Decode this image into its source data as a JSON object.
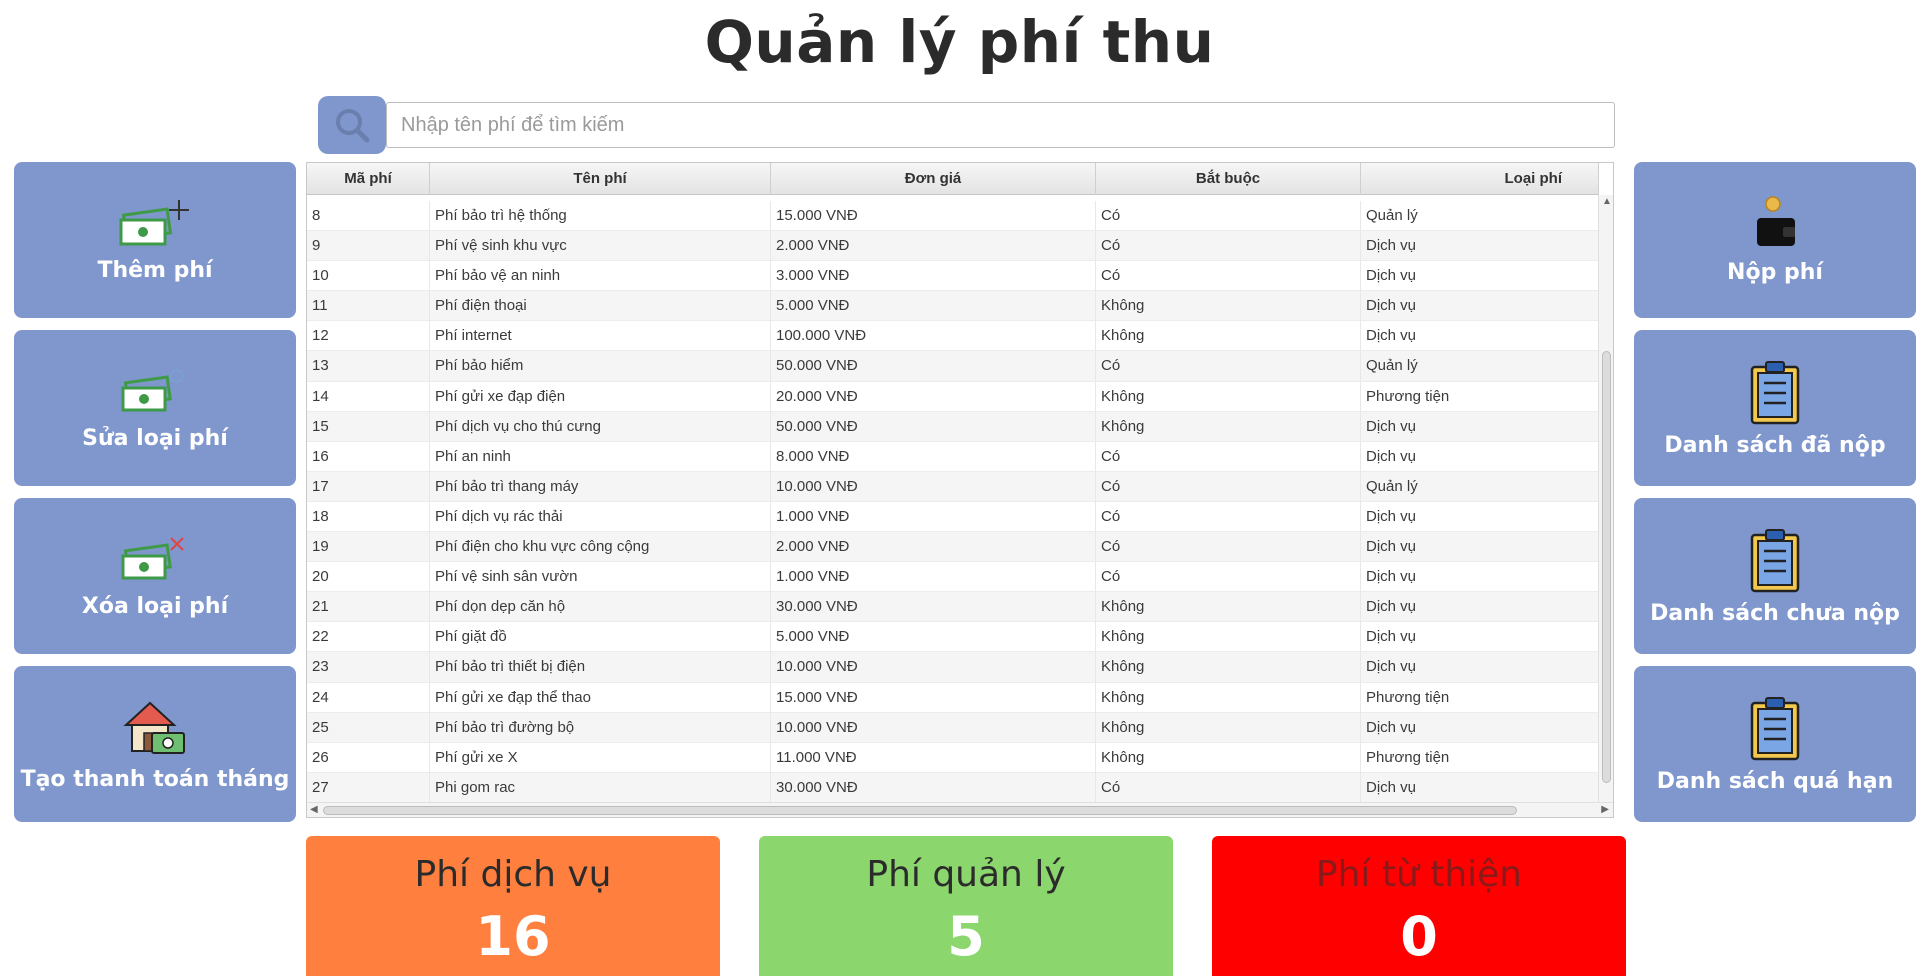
{
  "title": "Quản lý phí thu",
  "search": {
    "placeholder": "Nhập tên phí để tìm kiếm"
  },
  "left_buttons": [
    {
      "label": "Thêm phí",
      "icon": "money-add-icon"
    },
    {
      "label": "Sửa loại phí",
      "icon": "money-edit-icon"
    },
    {
      "label": "Xóa loại phí",
      "icon": "money-delete-icon"
    },
    {
      "label": "Tạo thanh toán tháng",
      "icon": "house-payment-icon"
    }
  ],
  "right_buttons": [
    {
      "label": "Nộp phí",
      "icon": "wallet-icon"
    },
    {
      "label": "Danh sách đã nộp",
      "icon": "clipboard-icon"
    },
    {
      "label": "Danh sách chưa nộp",
      "icon": "clipboard-icon"
    },
    {
      "label": "Danh sách quá hạn",
      "icon": "clipboard-icon"
    }
  ],
  "table": {
    "columns": [
      "Mã phí",
      "Tên phí",
      "Đơn giá",
      "Bắt buộc",
      "Loại phí"
    ],
    "rows": [
      [
        "8",
        "Phí bảo trì hệ thống",
        "15.000 VNĐ",
        "Có",
        "Quản lý"
      ],
      [
        "9",
        "Phí vệ sinh khu vực",
        "2.000 VNĐ",
        "Có",
        "Dịch vụ"
      ],
      [
        "10",
        "Phí bảo vệ an ninh",
        "3.000 VNĐ",
        "Có",
        "Dịch vụ"
      ],
      [
        "11",
        "Phí điện thoại",
        "5.000 VNĐ",
        "Không",
        "Dịch vụ"
      ],
      [
        "12",
        "Phí internet",
        "100.000 VNĐ",
        "Không",
        "Dịch vụ"
      ],
      [
        "13",
        "Phí bảo hiểm",
        "50.000 VNĐ",
        "Có",
        "Quản lý"
      ],
      [
        "14",
        "Phí gửi xe đạp điện",
        "20.000 VNĐ",
        "Không",
        "Phương tiện"
      ],
      [
        "15",
        "Phí dịch vụ cho thú cưng",
        "50.000 VNĐ",
        "Không",
        "Dịch vụ"
      ],
      [
        "16",
        "Phí an ninh",
        "8.000 VNĐ",
        "Có",
        "Dịch vụ"
      ],
      [
        "17",
        "Phí bảo trì thang máy",
        "10.000 VNĐ",
        "Có",
        "Quản lý"
      ],
      [
        "18",
        "Phí dịch vụ rác thải",
        "1.000 VNĐ",
        "Có",
        "Dịch vụ"
      ],
      [
        "19",
        "Phí điện cho khu vực công cộng",
        "2.000 VNĐ",
        "Có",
        "Dịch vụ"
      ],
      [
        "20",
        "Phí vệ sinh sân vườn",
        "1.000 VNĐ",
        "Có",
        "Dịch vụ"
      ],
      [
        "21",
        "Phí dọn dẹp căn hộ",
        "30.000 VNĐ",
        "Không",
        "Dịch vụ"
      ],
      [
        "22",
        "Phí giặt đồ",
        "5.000 VNĐ",
        "Không",
        "Dịch vụ"
      ],
      [
        "23",
        "Phí bảo trì thiết bị điện",
        "10.000 VNĐ",
        "Không",
        "Dịch vụ"
      ],
      [
        "24",
        "Phí gửi xe đạp thể thao",
        "15.000 VNĐ",
        "Không",
        "Phương tiện"
      ],
      [
        "25",
        "Phí bảo trì đường bộ",
        "10.000 VNĐ",
        "Không",
        "Dịch vụ"
      ],
      [
        "26",
        "Phí gửi xe X",
        "11.000 VNĐ",
        "Không",
        "Phương tiện"
      ],
      [
        "27",
        "Phi gom rac",
        "30.000 VNĐ",
        "Có",
        "Dịch vụ"
      ]
    ]
  },
  "stats": [
    {
      "label": "Phí dịch vụ",
      "value": "16",
      "color": "#ff7f3f"
    },
    {
      "label": "Phí quản lý",
      "value": "5",
      "color": "#8cd66e"
    },
    {
      "label": "Phí từ thiện",
      "value": "0",
      "color": "#ff0000"
    }
  ],
  "colors": {
    "button_bg": "#7f97cc",
    "money_green": "#3f9a48",
    "clipboard_yellow": "#f2c94c"
  }
}
